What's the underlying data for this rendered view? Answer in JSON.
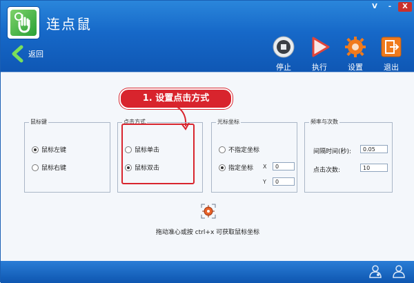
{
  "window": {
    "title": "连点鼠",
    "controls": [
      "V",
      "-",
      "X"
    ]
  },
  "header": {
    "back_label": "返回",
    "toolbar": [
      {
        "id": "stop",
        "label": "停止",
        "icon": "stop-icon"
      },
      {
        "id": "run",
        "label": "执行",
        "icon": "play-icon"
      },
      {
        "id": "settings",
        "label": "设置",
        "icon": "gear-icon"
      },
      {
        "id": "exit",
        "label": "退出",
        "icon": "exit-icon"
      }
    ]
  },
  "groups": {
    "mouse_button": {
      "title": "鼠标键",
      "options": [
        {
          "label": "鼠标左键",
          "selected": true
        },
        {
          "label": "鼠标右键",
          "selected": false
        }
      ]
    },
    "click_mode": {
      "title": "点击方式",
      "options": [
        {
          "label": "鼠标单击",
          "selected": false
        },
        {
          "label": "鼠标双击",
          "selected": true
        }
      ]
    },
    "cursor_coords": {
      "title": "光标坐标",
      "options": [
        {
          "label": "不指定坐标",
          "selected": false
        },
        {
          "label": "指定坐标",
          "selected": true
        }
      ],
      "x_label": "X",
      "y_label": "Y",
      "x_value": "0",
      "y_value": "0"
    },
    "frequency": {
      "title": "频率与次数",
      "interval_label": "间隔时间(秒):",
      "interval_value": "0.05",
      "count_label": "点击次数:",
      "count_value": "10"
    }
  },
  "hint": "拖动准心或按 ctrl+x 可获取鼠标坐标",
  "annotation": {
    "text": "1. 设置点击方式",
    "color": "#d8242d"
  },
  "colors": {
    "header": "#1668c8",
    "accent": "#d8242d"
  }
}
